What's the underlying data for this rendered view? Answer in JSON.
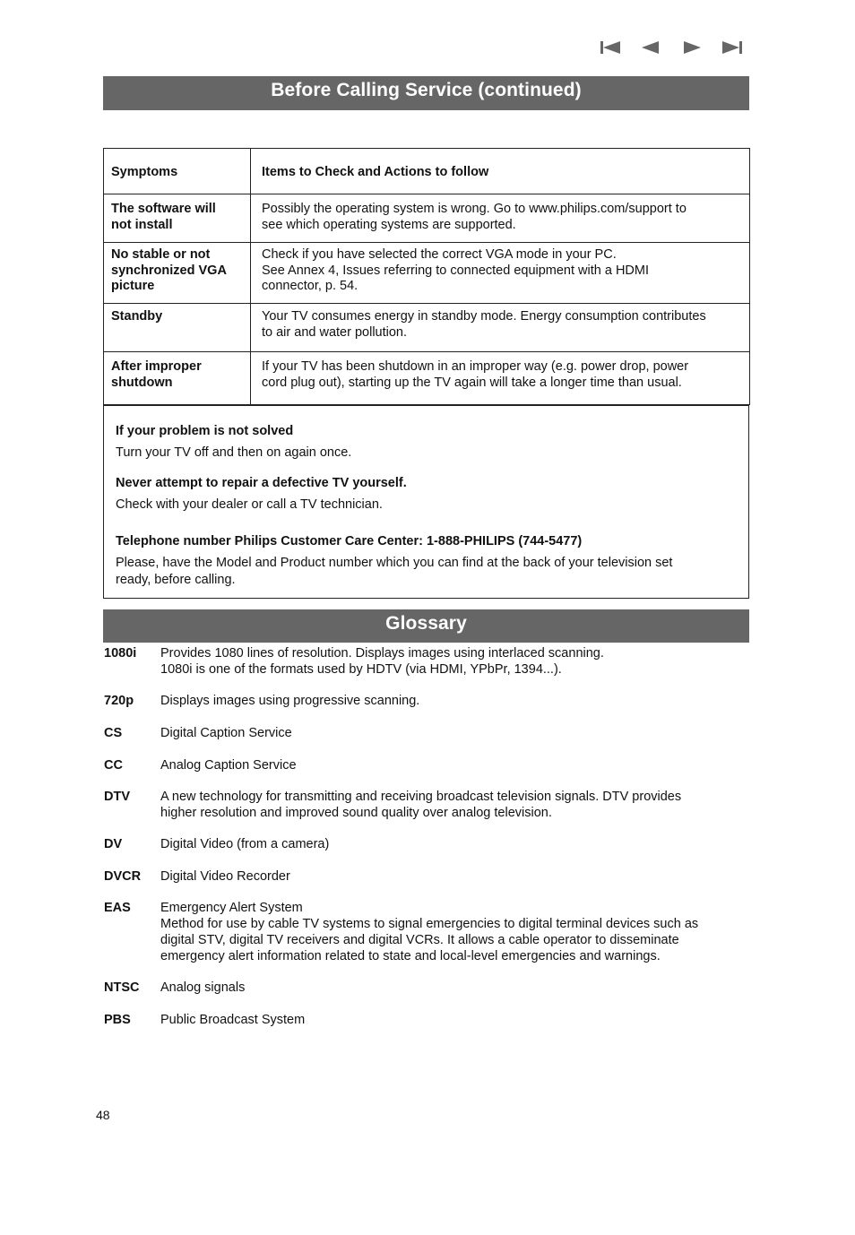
{
  "nav": {
    "icons": [
      "first-page-icon",
      "previous-page-icon",
      "next-page-icon",
      "last-page-icon"
    ],
    "color": "#666666"
  },
  "header": {
    "title": "Before Calling Service  (continued)"
  },
  "troubleshooting": {
    "columns": [
      "Symptoms",
      "Items to Check and Actions to follow"
    ],
    "rows": [
      {
        "symptom": [
          "The software will",
          "not install"
        ],
        "action": [
          "Possibly the operating system is wrong. Go to www.philips.com/support to",
          "see which operating systems are supported."
        ]
      },
      {
        "symptom": [
          "No stable or not",
          "synchronized VGA",
          "picture"
        ],
        "action": [
          "Check if you have selected the correct VGA mode in your PC.",
          "See Annex 4, Issues referring to connected equipment with a HDMI",
          "connector, p. 54."
        ]
      },
      {
        "symptom": [
          "Standby"
        ],
        "action": [
          "Your TV consumes energy in standby mode. Energy consumption contributes",
          "to air and water pollution."
        ]
      },
      {
        "symptom": [
          "After improper",
          "shutdown"
        ],
        "action": [
          "If your TV has been shutdown in an improper way (e.g. power drop, power",
          "cord plug out), starting up the TV again will take a longer time than usual."
        ]
      }
    ]
  },
  "help_box": {
    "blocks": [
      {
        "heading": "If your problem is not solved",
        "text": [
          "Turn your TV off and then on again once."
        ]
      },
      {
        "heading": "Never attempt to repair a defective TV yourself.",
        "text": [
          "Check with your dealer or call a TV technician."
        ]
      },
      {
        "heading": "Telephone number Philips Customer Care Center: 1-888-PHILIPS (744-5477)",
        "text": [
          "Please, have the Model and Product number which you can find at the back of your television set",
          "ready, before calling."
        ]
      }
    ]
  },
  "glossary": {
    "title": "Glossary",
    "entries": [
      {
        "term": "1080i",
        "def": [
          "Provides 1080 lines of resolution. Displays images using interlaced scanning.",
          "1080i is one of the formats used by HDTV (via HDMI, YPbPr, 1394...)."
        ]
      },
      {
        "term": "720p",
        "def": [
          "Displays images using progressive scanning."
        ]
      },
      {
        "term": "CS",
        "def": [
          "Digital Caption Service"
        ]
      },
      {
        "term": "CC",
        "def": [
          "Analog Caption Service"
        ]
      },
      {
        "term": "DTV",
        "def": [
          "A new technology for transmitting and receiving broadcast television signals. DTV provides",
          "higher resolution and improved sound quality over analog television."
        ]
      },
      {
        "term": "DV",
        "def": [
          "Digital Video (from a camera)"
        ]
      },
      {
        "term": "DVCR",
        "def": [
          "Digital Video Recorder"
        ]
      },
      {
        "term": "EAS",
        "def": [
          "Emergency Alert System",
          "Method for use by cable TV systems to signal emergencies to digital terminal devices such as",
          "digital STV, digital TV receivers and digital VCRs. It allows a cable operator to disseminate",
          "emergency alert information related to state and local-level emergencies and warnings."
        ]
      },
      {
        "term": "NTSC",
        "def": [
          "Analog signals"
        ]
      },
      {
        "term": "PBS",
        "def": [
          "Public Broadcast System"
        ]
      }
    ]
  },
  "footer": {
    "page_number": "48"
  }
}
